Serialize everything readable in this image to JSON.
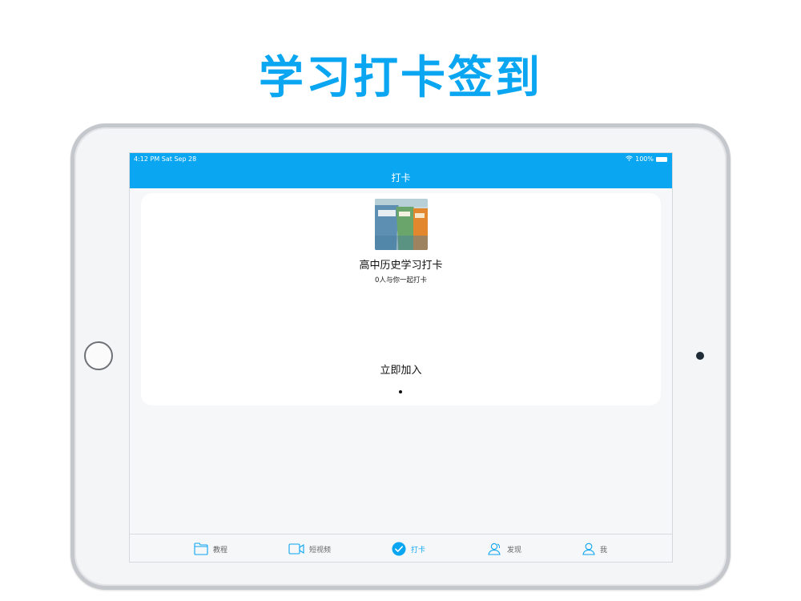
{
  "headline": "学习打卡签到",
  "status_bar": {
    "time": "4:12 PM   Sat Sep 28",
    "battery": "100%"
  },
  "nav": {
    "title": "打卡"
  },
  "card": {
    "title": "高中历史学习打卡",
    "subtitle": "0人与你一起打卡",
    "join_label": "立即加入"
  },
  "tabs": [
    {
      "label": "教程",
      "icon": "folder-icon"
    },
    {
      "label": "短视频",
      "icon": "video-camera-icon"
    },
    {
      "label": "打卡",
      "icon": "checkmark-circle-icon",
      "active": true
    },
    {
      "label": "发现",
      "icon": "people-icon"
    },
    {
      "label": "我",
      "icon": "person-icon"
    }
  ],
  "colors": {
    "accent": "#0aa6f2",
    "background": "#f6f7f9",
    "card": "#ffffff"
  }
}
